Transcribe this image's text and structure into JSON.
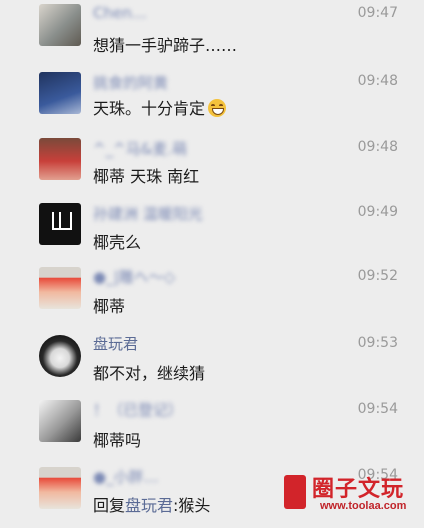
{
  "messages": [
    {
      "name": "Chen…",
      "message": "想猜一手驴蹄子……",
      "time": "09:47"
    },
    {
      "name": "挑食的阿黄",
      "message": "天珠。十分肯定",
      "emoji": "grinning-face",
      "time": "09:48"
    },
    {
      "name": "^_^马&麦.萌",
      "message": "椰蒂 天珠 南红",
      "time": "09:48"
    },
    {
      "name": "孙建洲 温暖阳光",
      "message": "椰壳么",
      "time": "09:49"
    },
    {
      "name": "●_|雕ヘ～◇",
      "message": "椰蒂",
      "time": "09:52"
    },
    {
      "name": "盘玩君",
      "message": "都不对，继续猜",
      "time": "09:53"
    },
    {
      "name": "！（已登记）",
      "message": "椰蒂吗",
      "time": "09:54"
    },
    {
      "name": "●_小胖…",
      "message_prefix": "回复",
      "message_mention": "盘玩君",
      "message_suffix": ":猴头",
      "time": "09:54"
    }
  ],
  "watermark": {
    "title": "圈子文玩",
    "url": "www.toolaa.com"
  }
}
